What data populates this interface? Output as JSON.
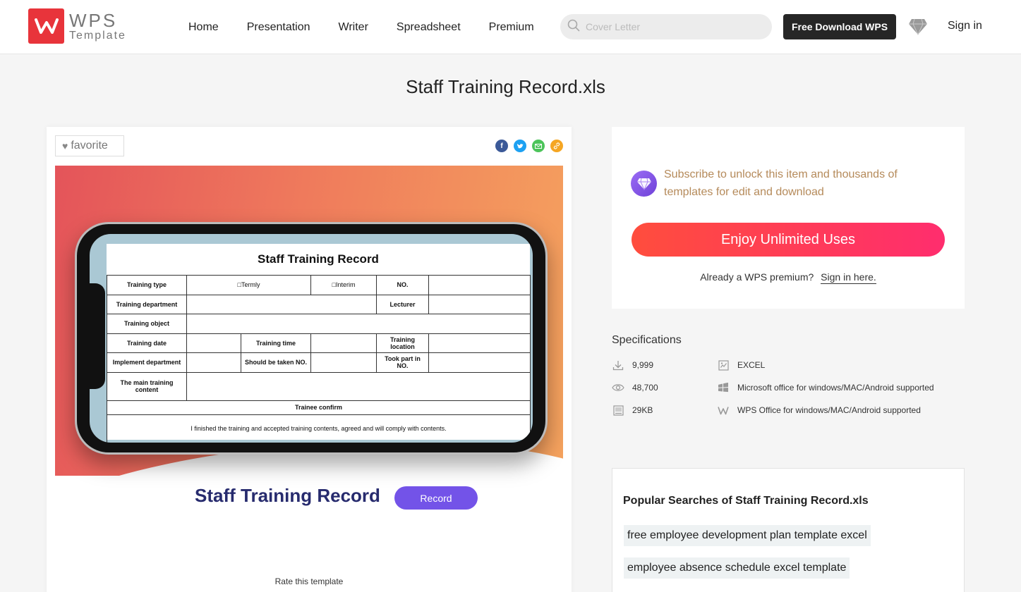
{
  "header": {
    "logo_wps": "WPS",
    "logo_template": "Template",
    "nav": [
      "Home",
      "Presentation",
      "Writer",
      "Spreadsheet",
      "Premium"
    ],
    "search_placeholder": "Cover Letter",
    "download_label": "Free Download WPS",
    "signin_label": "Sign in"
  },
  "page": {
    "title": "Staff Training Record.xls"
  },
  "preview": {
    "favorite_label": "favorite",
    "share_icons": [
      "facebook-icon",
      "twitter-icon",
      "email-icon",
      "link-icon"
    ],
    "sheet": {
      "title": "Staff Training Record",
      "rows": {
        "r1": [
          "Training type",
          "□Termly",
          "□Interim",
          "NO.",
          ""
        ],
        "r2": [
          "Training department",
          "",
          "Lecturer",
          ""
        ],
        "r3": [
          "Training object",
          ""
        ],
        "r4": [
          "Training date",
          "",
          "Training time",
          "",
          "Training location",
          ""
        ],
        "r5": [
          "Implement department",
          "",
          "Should be taken NO.",
          "",
          "Took part in NO.",
          ""
        ],
        "r6": [
          "The main training content",
          ""
        ],
        "r7": [
          "Trainee confirm"
        ],
        "r8": [
          "I finished the training and accepted training contents, agreed and will comply with contents."
        ]
      }
    },
    "banner_title": "Staff Training Record",
    "banner_button": "Record",
    "rate_label": "Rate this template"
  },
  "subscribe": {
    "text": "Subscribe to unlock this item and thousands of templates for edit and download",
    "button": "Enjoy Unlimited Uses",
    "already": "Already a WPS premium?",
    "signin_link": "Sign in here."
  },
  "specs": {
    "title": "Specifications",
    "downloads": "9,999",
    "views": "48,700",
    "size": "29KB",
    "format": "EXCEL",
    "ms_support": "Microsoft office for windows/MAC/Android supported",
    "wps_support": "WPS Office for windows/MAC/Android supported"
  },
  "popular": {
    "title": "Popular Searches of Staff Training Record.xls",
    "tags": [
      "free employee development plan template excel",
      "employee absence schedule excel template"
    ]
  },
  "colors": {
    "brand_red": "#e8343b",
    "accent_purple": "#7353e8",
    "cta_start": "#ff4d3d",
    "cta_end": "#ff2d6e"
  }
}
